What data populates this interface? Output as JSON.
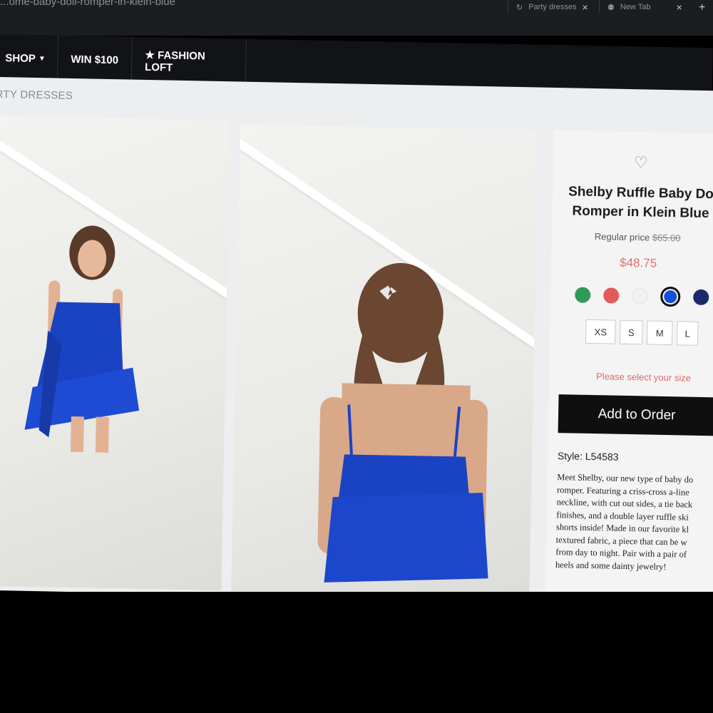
{
  "browser": {
    "url": "...ome-baby-doll-romper-in-klein-blue",
    "tabs": [
      {
        "label": "Party dresses"
      },
      {
        "label": "New Tab"
      }
    ]
  },
  "nav": {
    "items": [
      {
        "label": "SHOP"
      },
      {
        "label": "WIN $100"
      },
      {
        "label": "★ FASHION LOFT"
      }
    ]
  },
  "breadcrumb": "RTY DRESSES",
  "product": {
    "title_line1": "Shelby Ruffle Baby Do",
    "title_line2": "Romper in Klein Blue",
    "regular_label": "Regular price",
    "regular_price": "$65.00",
    "sale_price": "$48.75",
    "colors": [
      {
        "name": "green",
        "hex": "#2e9a5a"
      },
      {
        "name": "red",
        "hex": "#e35a5a"
      },
      {
        "name": "white",
        "hex": "#f2f2f2"
      },
      {
        "name": "blue",
        "hex": "#1550d6",
        "selected": true
      },
      {
        "name": "navy",
        "hex": "#1a2a6a"
      }
    ],
    "sizes": [
      "XS",
      "S",
      "M",
      "L"
    ],
    "size_warning": "Please select your size",
    "add_button": "Add to Order",
    "style": "Style: L54583",
    "description_lines": [
      "Meet Shelby, our new type of baby do",
      "romper. Featuring a criss-cross a-line",
      "neckline, with cut out sides, a tie back",
      "finishes, and a double layer ruffle ski",
      "shorts inside! Made in our favorite kl",
      "textured fabric, a piece that can be w",
      "from day to night. Pair with a pair of",
      "heels and some dainty jewelry!"
    ]
  },
  "colors": {
    "dress_blue": "#1a43c4",
    "nav_bg": "#121317",
    "accent_red": "#e46e6c"
  }
}
